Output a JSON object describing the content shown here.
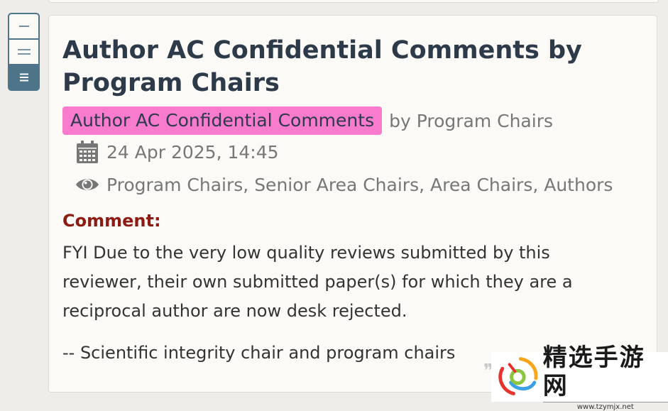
{
  "controls": {
    "collapse_label": "−",
    "partial_label": "=",
    "expand_label": "≡"
  },
  "note": {
    "title": "Author AC Confidential Comments by Program Chairs",
    "invitation": "Author AC Confidential Comments",
    "signatures": "by Program Chairs",
    "date": "24 Apr 2025, 14:45",
    "readers": "Program Chairs, Senior Area Chairs, Area Chairs, Authors",
    "comment_label": "Comment:",
    "comment_text": "FYI Due to the very low quality reviews submitted by this reviewer, their own submitted paper(s) for which they are a reciprocal author are now desk rejected.",
    "comment_sign": "-- Scientific integrity chair and program chairs"
  },
  "icons": {
    "date": "calendar-icon",
    "readers": "eye-icon"
  },
  "colors": {
    "badge": "#f97bce",
    "accent": "#4d7489",
    "field_label": "#8c1b13",
    "title": "#2c3a4a"
  },
  "watermark": {
    "title": "精选手游网",
    "url": "www.tzymjx.net"
  }
}
